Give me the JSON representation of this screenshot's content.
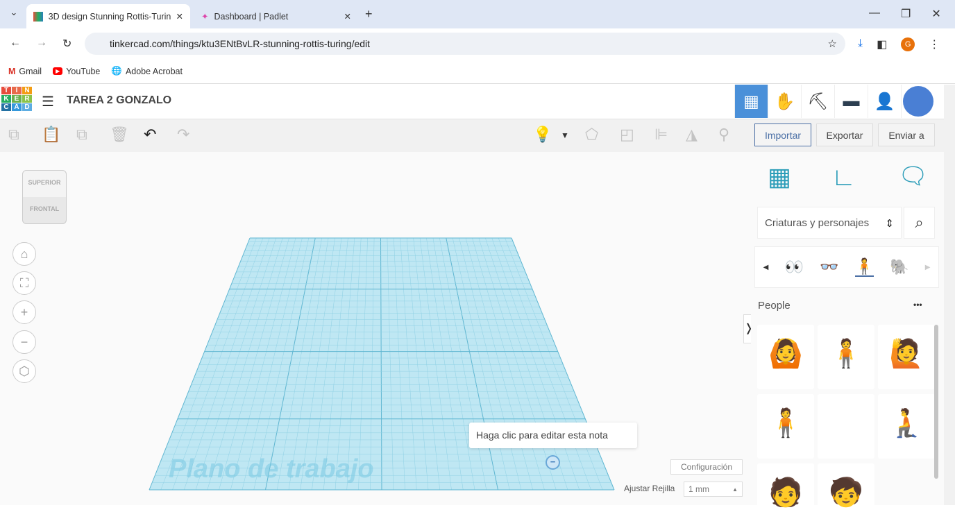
{
  "browser": {
    "tabs": [
      {
        "title": "3D design Stunning Rottis-Turing",
        "active": true
      },
      {
        "title": "Dashboard | Padlet",
        "active": false
      }
    ],
    "url": "tinkercad.com/things/ktu3ENtBvLR-stunning-rottis-turing/edit",
    "bookmarks": [
      "Gmail",
      "YouTube",
      "Adobe Acrobat"
    ],
    "profile_initial": "G"
  },
  "app": {
    "logo": [
      "T",
      "I",
      "N",
      "K",
      "E",
      "R",
      "C",
      "A",
      "D"
    ],
    "design_title": "TAREA 2 GONZALO",
    "actions": {
      "import": "Importar",
      "export": "Exportar",
      "send": "Enviar a"
    },
    "viewcube": {
      "top": "SUPERIOR",
      "front": "FRONTAL"
    },
    "workplane_label": "Plano de trabajo",
    "note": "Haga clic para editar esta nota",
    "settings": "Configuración",
    "snap_label": "Ajustar Rejilla",
    "snap_value": "1 mm"
  },
  "panel": {
    "category": "Criaturas y personajes",
    "section": "People",
    "more": "•••"
  },
  "colors": {
    "accent": "#4a90d9",
    "grid": "#a8dcec"
  }
}
